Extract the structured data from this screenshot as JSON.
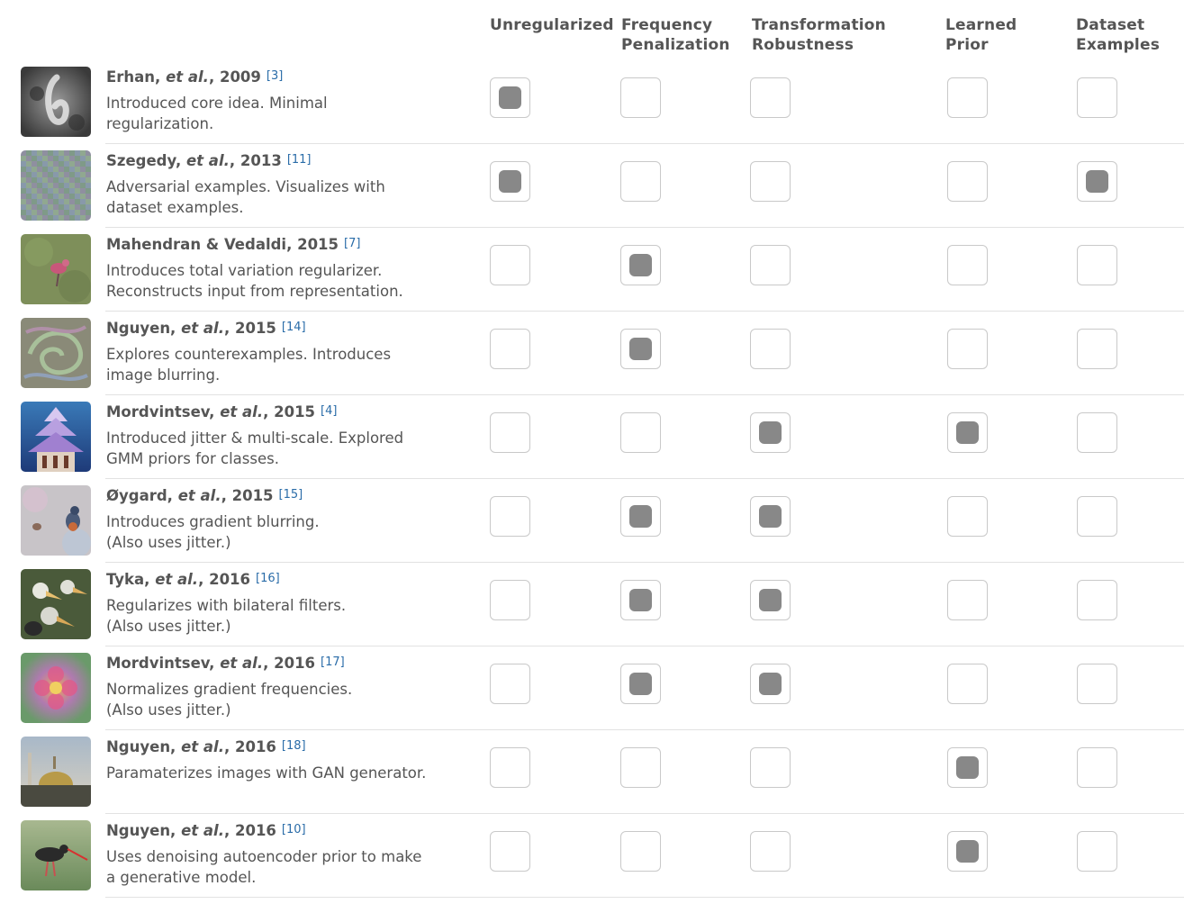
{
  "columns": [
    {
      "label": "Unregularized"
    },
    {
      "label": "Frequency\nPenalization"
    },
    {
      "label": "Transformation\nRobustness"
    },
    {
      "label": "Learned\nPrior"
    },
    {
      "label": "Dataset\nExamples"
    }
  ],
  "colors": {
    "checked_fill": "#888888",
    "reference_link": "#2a6ca8",
    "text": "#555555"
  },
  "rows": [
    {
      "author": "Erhan,",
      "etal": "et al.",
      "year": ", 2009",
      "ref": "[3]",
      "desc": "Introduced core idea. Minimal\nregularization.",
      "checks": [
        true,
        false,
        false,
        false,
        false
      ],
      "thumb": "grayscale-digit"
    },
    {
      "author": "Szegedy,",
      "etal": "et al.",
      "year": ", 2013",
      "ref": "[11]",
      "desc": "Adversarial examples. Visualizes with\ndataset examples.",
      "checks": [
        true,
        false,
        false,
        false,
        true
      ],
      "thumb": "noise"
    },
    {
      "author": "Mahendran & Vedaldi",
      "etal": "",
      "year": ", 2015",
      "ref": "[7]",
      "desc": "Introduces total variation regularizer.\nReconstructs input from representation.",
      "checks": [
        false,
        true,
        false,
        false,
        false
      ],
      "thumb": "bird-green"
    },
    {
      "author": "Nguyen,",
      "etal": "et al.",
      "year": ", 2015",
      "ref": "[14]",
      "desc": "Explores counterexamples. Introduces\nimage blurring.",
      "checks": [
        false,
        true,
        false,
        false,
        false
      ],
      "thumb": "swirl"
    },
    {
      "author": "Mordvintsev,",
      "etal": "et al.",
      "year": ", 2015",
      "ref": "[4]",
      "desc": "Introduced jitter & multi-scale. Explored\nGMM priors for classes.",
      "checks": [
        false,
        false,
        true,
        true,
        false
      ],
      "thumb": "pagoda"
    },
    {
      "author": "Øygard,",
      "etal": "et al.",
      "year": ", 2015",
      "ref": "[15]",
      "desc": "Introduces gradient blurring.\n(Also uses jitter.)",
      "checks": [
        false,
        true,
        true,
        false,
        false
      ],
      "thumb": "birds-pastel"
    },
    {
      "author": "Tyka,",
      "etal": "et al.",
      "year": ", 2016",
      "ref": "[16]",
      "desc": "Regularizes with bilateral filters.\n(Also uses jitter.)",
      "checks": [
        false,
        true,
        true,
        false,
        false
      ],
      "thumb": "pelicans"
    },
    {
      "author": "Mordvintsev,",
      "etal": "et al.",
      "year": ", 2016",
      "ref": "[17]",
      "desc": "Normalizes gradient frequencies.\n(Also uses jitter.)",
      "checks": [
        false,
        true,
        true,
        false,
        false
      ],
      "thumb": "flower"
    },
    {
      "author": "Nguyen,",
      "etal": "et al.",
      "year": ", 2016",
      "ref": "[18]",
      "desc": "Paramaterizes images with GAN generator.",
      "checks": [
        false,
        false,
        false,
        true,
        false
      ],
      "thumb": "mosque"
    },
    {
      "author": "Nguyen,",
      "etal": "et al.",
      "year": ", 2016",
      "ref": "[10]",
      "desc": "Uses denoising autoencoder prior to make\na generative model.",
      "checks": [
        false,
        false,
        false,
        true,
        false
      ],
      "thumb": "wading-bird"
    }
  ]
}
